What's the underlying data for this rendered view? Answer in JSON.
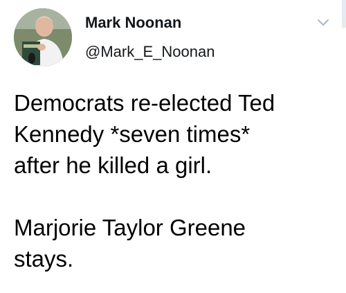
{
  "tweet": {
    "author": {
      "display_name": "Mark Noonan",
      "handle": "@Mark_E_Noonan",
      "avatar_icon": "user-avatar-photo"
    },
    "menu_icon": "chevron-down-icon",
    "text_lines_para1": [
      "Democrats re-elected Ted",
      "Kennedy *seven times*",
      "after he killed a girl."
    ],
    "text_lines_para2": [
      "Marjorie Taylor Greene",
      "stays."
    ]
  },
  "colors": {
    "text": "#000000",
    "secondary": "#aab8c2",
    "background": "#ffffff"
  }
}
